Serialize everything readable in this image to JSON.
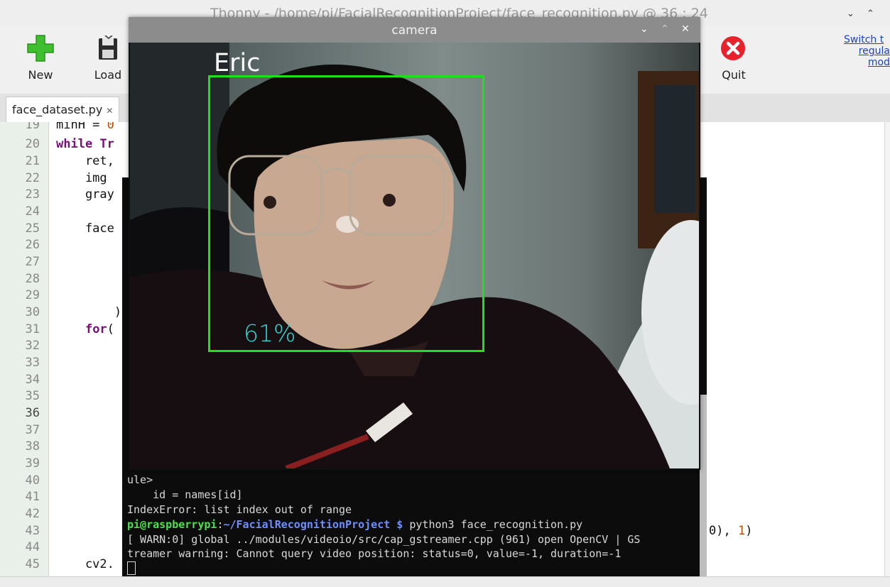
{
  "thonny": {
    "window_title": "Thonny  -  /home/pi/FacialRecognitionProject/face_recognition.py  @  36 : 24",
    "toolbar": {
      "new_label": "New",
      "load_label": "Load",
      "quit_label": "Quit"
    },
    "switch_link": {
      "line1": "Switch t",
      "line2": "regula",
      "line3": "mod"
    },
    "tab_label": "face_dataset.py",
    "tab_close": "✕",
    "line_numbers": [
      "19",
      "20",
      "21",
      "22",
      "23",
      "24",
      "25",
      "26",
      "27",
      "28",
      "29",
      "30",
      "31",
      "32",
      "33",
      "34",
      "35",
      "36",
      "37",
      "38",
      "39",
      "40",
      "41",
      "42",
      "43",
      "44",
      "45"
    ],
    "code": {
      "l19_a": "minH = ",
      "l19_b": "0",
      "l20_kw": "while",
      "l20_rest": " Tr",
      "l21": "    ret,",
      "l22": "    img",
      "l23": "    gray",
      "l25": "    face",
      "l30": "        )",
      "l31_kw": "for",
      "l31_rest": "(",
      "l43_a": "0), ",
      "l43_b": "1",
      "l43_c": ")",
      "l45": "    cv2."
    }
  },
  "terminal": {
    "line_ule": "ule>",
    "line_id": "    id = names[id]",
    "line_err": "IndexError: list index out of range",
    "prompt_user": "pi@raspberrypi",
    "prompt_sep": ":",
    "prompt_path": "~/FacialRecognitionProject $",
    "prompt_cmd": " python3 face_recognition.py",
    "warn1": "[ WARN:0] global ../modules/videoio/src/cap_gstreamer.cpp (961) open OpenCV | GS",
    "warn2": "treamer warning: Cannot query video position: status=0, value=-1, duration=-1"
  },
  "camera": {
    "window_title": "camera",
    "name_label": "Eric",
    "confidence_label": "61%",
    "box_color": "#1fe01f",
    "name_color": "#ffffff",
    "confidence_color": "#33d6d6"
  },
  "icons": [
    "plus-icon",
    "floppy-disk-icon",
    "quit-icon",
    "close-icon",
    "chevron-down-icon",
    "chevron-up-icon"
  ]
}
